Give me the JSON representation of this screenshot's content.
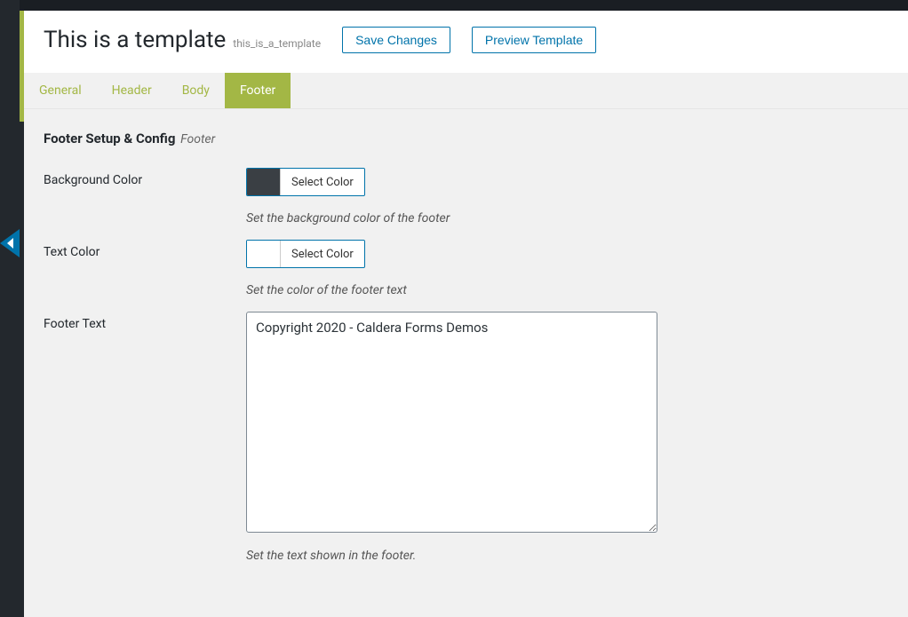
{
  "header": {
    "title": "This is a template",
    "slug": "this_is_a_template",
    "save_button": "Save Changes",
    "preview_button": "Preview Template"
  },
  "tabs": [
    {
      "label": "General",
      "active": false
    },
    {
      "label": "Header",
      "active": false
    },
    {
      "label": "Body",
      "active": false
    },
    {
      "label": "Footer",
      "active": true
    }
  ],
  "section": {
    "title": "Footer Setup & Config",
    "subtitle": "Footer"
  },
  "fields": {
    "background_color": {
      "label": "Background Color",
      "button_label": "Select Color",
      "swatch": "#3a3f44",
      "help": "Set the background color of the footer"
    },
    "text_color": {
      "label": "Text Color",
      "button_label": "Select Color",
      "swatch": "#ffffff",
      "help": "Set the color of the footer text"
    },
    "footer_text": {
      "label": "Footer Text",
      "value": "Copyright 2020 - Caldera Forms Demos",
      "help": "Set the text shown in the footer."
    }
  }
}
